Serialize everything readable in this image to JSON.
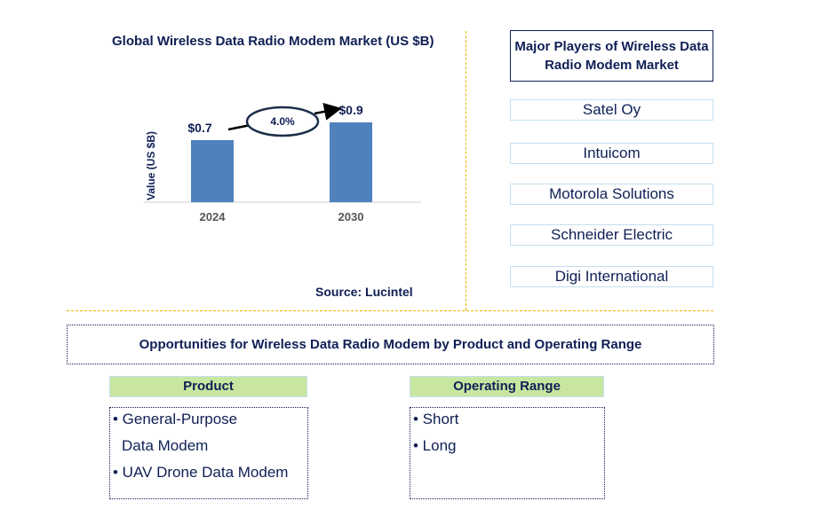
{
  "chart_data": {
    "type": "bar",
    "title": "Global Wireless Data Radio Modem Market (US $B)",
    "ylabel": "Value (US $B)",
    "xlabel": "",
    "categories": [
      "2024",
      "2030"
    ],
    "values": [
      0.7,
      0.9
    ],
    "data_labels": [
      "$0.7",
      "$0.9"
    ],
    "ylim": [
      0,
      1
    ],
    "grid": false,
    "bar_color": "#4f81bd",
    "annotation": {
      "label": "4.0%",
      "type": "CAGR ellipse with arrow"
    }
  },
  "source": "Source: Lucintel",
  "players": {
    "title": "Major Players of Wireless Data Radio Modem Market",
    "items": [
      "Satel Oy",
      "Intuicom",
      "Motorola Solutions",
      "Schneider Electric",
      "Digi International"
    ]
  },
  "opportunities": {
    "title": "Opportunities for Wireless Data Radio Modem by Product and Operating Range",
    "product": {
      "header": "Product",
      "lines": [
        "• General-Purpose",
        "  Data Modem",
        "• UAV Drone Data Modem"
      ]
    },
    "operating_range": {
      "header": "Operating Range",
      "lines": [
        "• Short",
        "• Long"
      ]
    }
  },
  "colors": {
    "accent_text": "#0f1f55",
    "header_green": "#c8e6a0",
    "divider": "#f2b400"
  }
}
